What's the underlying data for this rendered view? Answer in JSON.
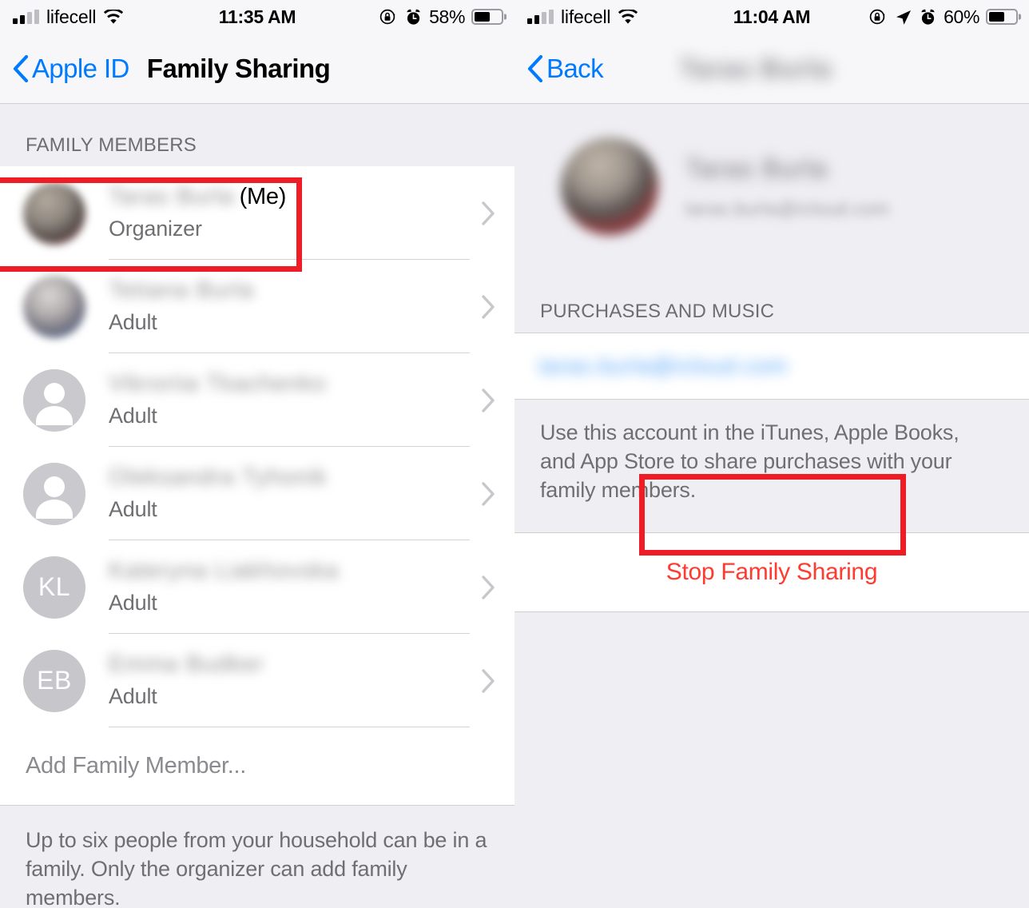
{
  "left": {
    "status_bar": {
      "carrier": "lifecell",
      "time": "11:35 AM",
      "battery_percent": "58%",
      "icons": [
        "signal-bars-icon",
        "wifi-icon",
        "rotation-lock-icon",
        "alarm-icon",
        "battery-icon"
      ]
    },
    "nav": {
      "back_label": "Apple ID",
      "title": "Family Sharing"
    },
    "section_header": "FAMILY MEMBERS",
    "members": [
      {
        "name": "",
        "me_tag": "(Me)",
        "role": "Organizer",
        "avatar_type": "photo-a",
        "initials": ""
      },
      {
        "name": "",
        "me_tag": "",
        "role": "Adult",
        "avatar_type": "photo-b",
        "initials": ""
      },
      {
        "name": "",
        "me_tag": "",
        "role": "Adult",
        "avatar_type": "glyph",
        "initials": ""
      },
      {
        "name": "",
        "me_tag": "",
        "role": "Adult",
        "avatar_type": "glyph",
        "initials": ""
      },
      {
        "name": "",
        "me_tag": "",
        "role": "Adult",
        "avatar_type": "initials",
        "initials": "KL"
      },
      {
        "name": "",
        "me_tag": "",
        "role": "Adult",
        "avatar_type": "initials",
        "initials": "EB"
      }
    ],
    "add_member_label": "Add Family Member...",
    "footer_note": "Up to six people from your household can be in a family. Only the organizer can add family members."
  },
  "right": {
    "status_bar": {
      "carrier": "lifecell",
      "time": "11:04 AM",
      "battery_percent": "60%",
      "icons": [
        "signal-bars-icon",
        "wifi-icon",
        "rotation-lock-icon",
        "location-arrow-icon",
        "alarm-icon",
        "battery-icon"
      ]
    },
    "nav": {
      "back_label": "Back",
      "title": ""
    },
    "profile": {
      "name": "",
      "email": ""
    },
    "section_header": "PURCHASES AND MUSIC",
    "account_email": "",
    "description": "Use this account in the iTunes, Apple Books, and App Store to share purchases with your family members.",
    "stop_label": "Stop Family Sharing"
  },
  "annotations": {
    "member_row_highlight": "red-box-organizer-row",
    "stop_sharing_highlight": "red-box-stop-family-sharing"
  },
  "colors": {
    "accent_blue": "#007aff",
    "destructive_red": "#ff3b30",
    "annotation_red": "#ee1c25",
    "group_background": "#efeef3",
    "cell_background": "#ffffff"
  }
}
